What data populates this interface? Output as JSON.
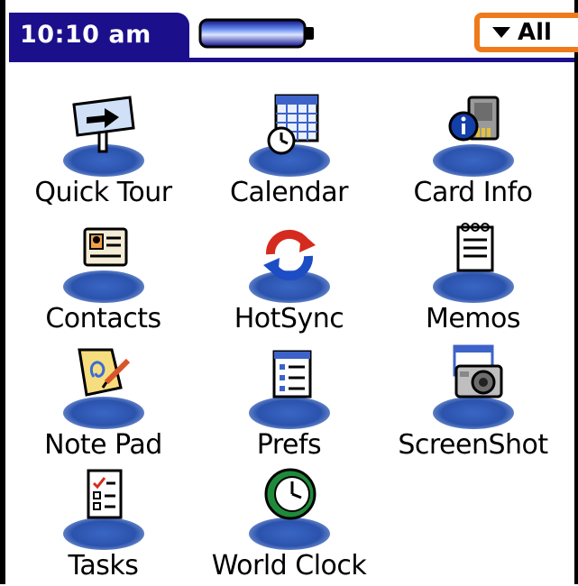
{
  "status_bar": {
    "time": "10:10 am",
    "category_selector": "All",
    "colors": {
      "title_bar": "#1c0f8c",
      "category_highlight": "#ef7a1a"
    }
  },
  "launcher": {
    "apps": [
      {
        "label": "Quick Tour",
        "icon": "quick-tour-icon"
      },
      {
        "label": "Calendar",
        "icon": "calendar-icon"
      },
      {
        "label": "Card Info",
        "icon": "card-info-icon"
      },
      {
        "label": "Contacts",
        "icon": "contacts-icon"
      },
      {
        "label": "HotSync",
        "icon": "hotsync-icon"
      },
      {
        "label": "Memos",
        "icon": "memos-icon"
      },
      {
        "label": "Note Pad",
        "icon": "note-pad-icon"
      },
      {
        "label": "Prefs",
        "icon": "prefs-icon"
      },
      {
        "label": "ScreenShot",
        "icon": "screenshot-icon"
      },
      {
        "label": "Tasks",
        "icon": "tasks-icon"
      },
      {
        "label": "World Clock",
        "icon": "world-clock-icon"
      }
    ]
  }
}
